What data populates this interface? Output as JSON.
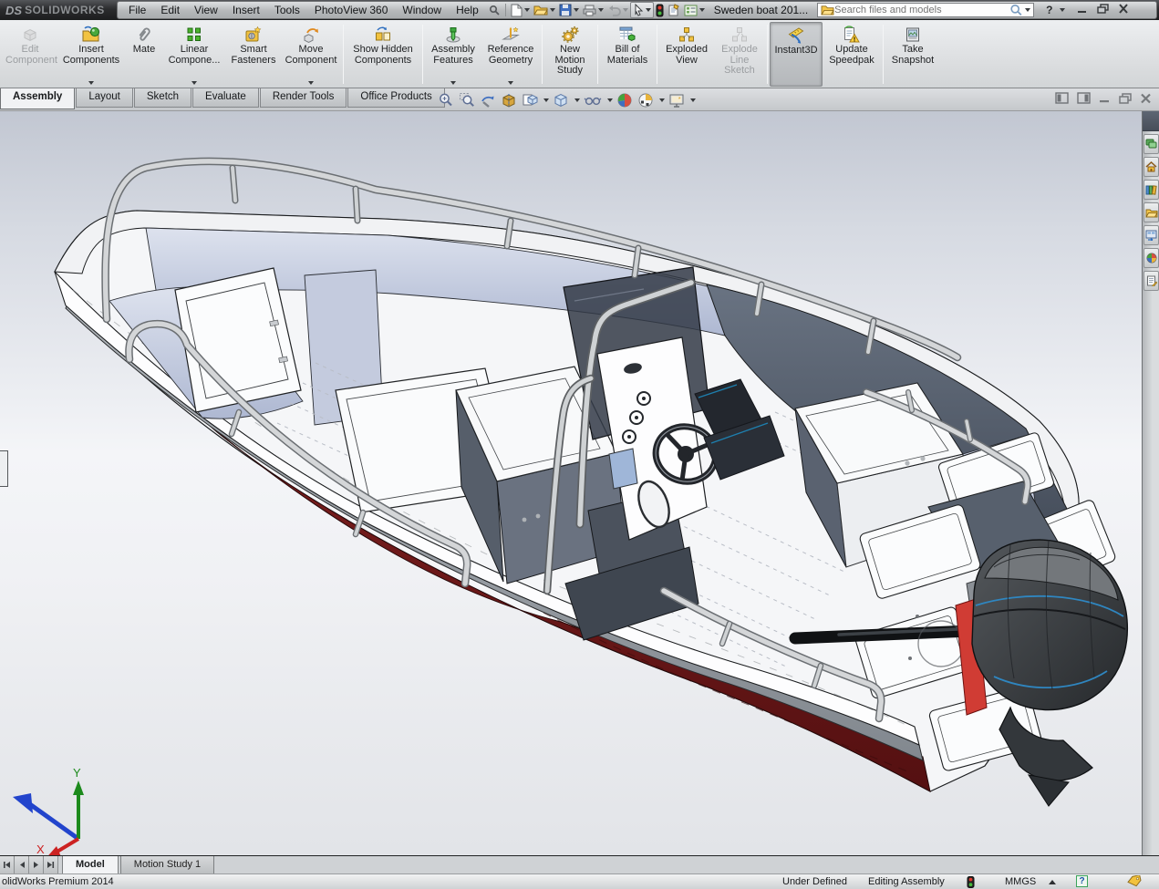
{
  "titlebar": {
    "brand": {
      "mark": "DS",
      "name": "SOLIDWORKS"
    },
    "menus": [
      "File",
      "Edit",
      "View",
      "Insert",
      "Tools",
      "PhotoView 360",
      "Window",
      "Help"
    ],
    "document_title": "Sweden boat 201...",
    "search": {
      "placeholder": "Search files and models"
    },
    "help_glyph": "?",
    "quick_access_icons": [
      "pin-icon",
      "new-document-icon",
      "open-icon",
      "save-icon",
      "print-icon",
      "undo-icon",
      "select-cursor-icon",
      "rebuild-traffic-light-icon",
      "file-properties-icon",
      "options-icon"
    ]
  },
  "ribbon": {
    "buttons": [
      {
        "label": "Edit Component",
        "icon": "edit-component-icon",
        "state": "disabled"
      },
      {
        "label": "Insert Components",
        "icon": "insert-components-icon",
        "dropdown": true
      },
      {
        "label": "Mate",
        "icon": "mate-icon"
      },
      {
        "label": "Linear Compone...",
        "icon": "linear-component-pattern-icon",
        "dropdown": true
      },
      {
        "label": "Smart Fasteners",
        "icon": "smart-fasteners-icon"
      },
      {
        "label": "Move Component",
        "icon": "move-component-icon",
        "dropdown": true
      },
      {
        "label": "Show Hidden Components",
        "icon": "show-hidden-components-icon"
      },
      {
        "label": "Assembly Features",
        "icon": "assembly-features-icon",
        "dropdown": true
      },
      {
        "label": "Reference Geometry",
        "icon": "reference-geometry-icon",
        "dropdown": true
      },
      {
        "label": "New Motion Study",
        "icon": "new-motion-study-icon"
      },
      {
        "label": "Bill of Materials",
        "icon": "bill-of-materials-icon"
      },
      {
        "label": "Exploded View",
        "icon": "exploded-view-icon"
      },
      {
        "label": "Explode Line Sketch",
        "icon": "explode-line-sketch-icon",
        "state": "disabled"
      },
      {
        "label": "Instant3D",
        "icon": "instant3d-icon",
        "state": "active"
      },
      {
        "label": "Update Speedpak",
        "icon": "update-speedpak-icon"
      },
      {
        "label": "Take Snapshot",
        "icon": "take-snapshot-icon"
      }
    ]
  },
  "command_tabs": {
    "tabs": [
      {
        "label": "Assembly",
        "active": true
      },
      {
        "label": "Layout",
        "active": false
      },
      {
        "label": "Sketch",
        "active": false
      },
      {
        "label": "Evaluate",
        "active": false
      },
      {
        "label": "Render Tools",
        "active": false
      },
      {
        "label": "Office Products",
        "active": false
      }
    ]
  },
  "headsup_toolbar": {
    "icons": [
      {
        "name": "zoom-to-fit-icon",
        "dropdown": false
      },
      {
        "name": "zoom-to-area-icon",
        "dropdown": false
      },
      {
        "name": "previous-view-icon",
        "dropdown": false
      },
      {
        "name": "section-view-icon",
        "dropdown": false
      },
      {
        "name": "view-orientation-icon",
        "dropdown": true
      },
      {
        "name": "display-style-icon",
        "dropdown": true
      },
      {
        "name": "hide-show-items-icon",
        "dropdown": true
      },
      {
        "name": "edit-appearance-icon",
        "dropdown": false
      },
      {
        "name": "apply-scene-icon",
        "dropdown": true
      },
      {
        "name": "view-settings-icon",
        "dropdown": true
      }
    ]
  },
  "taskpane": {
    "icons": [
      "forum-icon",
      "resources-home-icon",
      "design-library-icon",
      "file-explorer-icon",
      "view-palette-icon",
      "appearances-scenes-icon",
      "custom-properties-icon"
    ]
  },
  "viewport": {
    "triad": {
      "x": "X",
      "y": "Y"
    }
  },
  "bottombar": {
    "tabs": [
      {
        "label": "Model",
        "active": true
      },
      {
        "label": "Motion Study 1",
        "active": false
      }
    ]
  },
  "statusbar": {
    "product": "olidWorks Premium 2014",
    "state": "Under Defined",
    "mode": "Editing Assembly",
    "units": "MMGS",
    "help_glyph": "?"
  }
}
